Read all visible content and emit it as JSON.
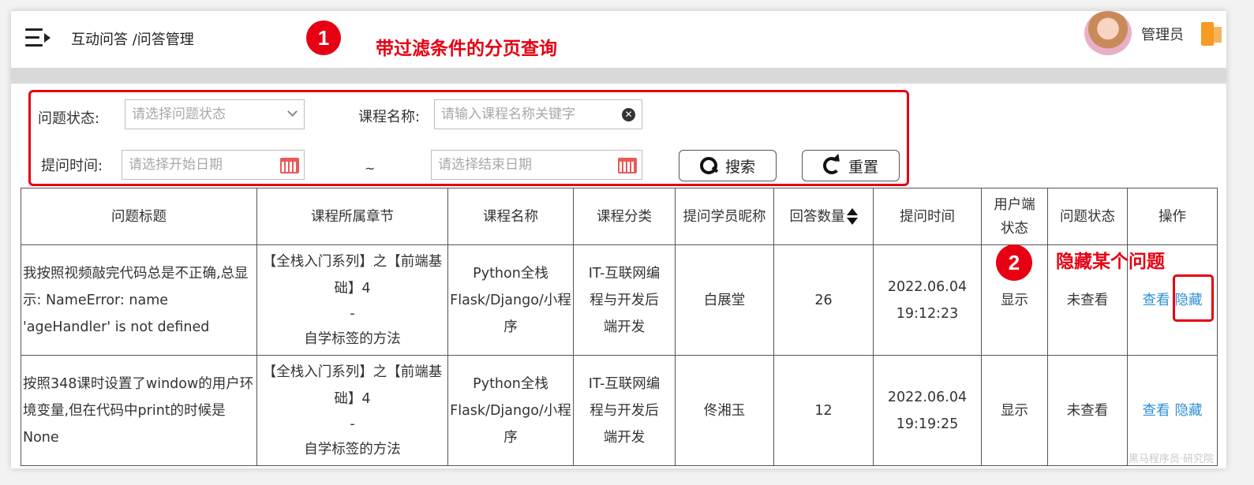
{
  "header": {
    "breadcrumb": "互动问答 /问答管理",
    "user_name": "管理员"
  },
  "annotations": {
    "badge1": "1",
    "note1": "带过滤条件的分页查询",
    "badge2": "2",
    "note2": "隐藏某个问题"
  },
  "filter": {
    "status_label": "问题状态:",
    "status_placeholder": "请选择问题状态",
    "course_label": "课程名称:",
    "course_placeholder": "请输入课程名称关键字",
    "time_label": "提问时间:",
    "start_placeholder": "请选择开始日期",
    "separator": "~",
    "end_placeholder": "请选择结束日期",
    "search_label": "搜索",
    "reset_label": "重置"
  },
  "table": {
    "headers": [
      "问题标题",
      "课程所属章节",
      "课程名称",
      "课程分类",
      "提问学员昵称",
      "回答数量",
      "提问时间",
      "用户端状态",
      "问题状态",
      "操作"
    ],
    "rows": [
      {
        "title": "我按照视频敲完代码总是不正确,总显示: NameError: name 'ageHandler' is not defined",
        "chapter_1": "【全栈入门系列】之【前端基础】4",
        "chapter_2": "-",
        "chapter_3": "自学标签的方法",
        "course": "Python全栈Flask/Django/小程序",
        "category": "IT-互联网编程与开发后端开发",
        "student": "白展堂",
        "answers": "26",
        "date": "2022.06.04",
        "time": "19:12:23",
        "user_status": "显示",
        "status": "未查看",
        "view": "查看",
        "hide": "隐藏"
      },
      {
        "title": "按照348课时设置了window的用户环境变量,但在代码中print的时候是None",
        "chapter_1": "【全栈入门系列】之【前端基础】4",
        "chapter_2": "-",
        "chapter_3": "自学标签的方法",
        "course": "Python全栈Flask/Django/小程序",
        "category": "IT-互联网编程与开发后端开发",
        "student": "佟湘玉",
        "answers": "12",
        "date": "2022.06.04",
        "time": "19:19:25",
        "user_status": "显示",
        "status": "未查看",
        "view": "查看",
        "hide": "隐藏"
      }
    ]
  },
  "watermark": "黑马程序员·研究院",
  "colors": {
    "accent_red": "#e60012",
    "link_blue": "#2e8fd6"
  }
}
